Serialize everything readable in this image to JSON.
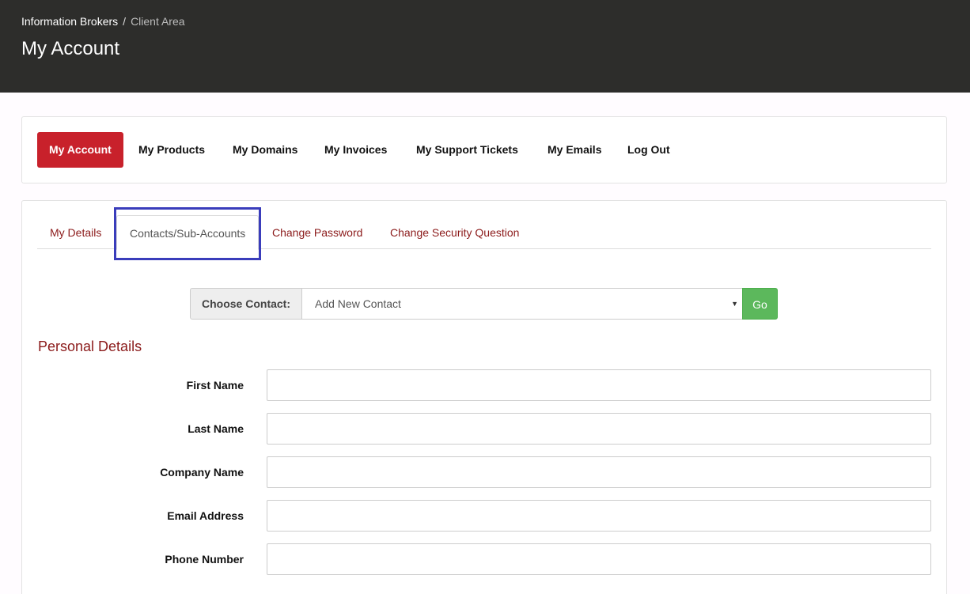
{
  "header": {
    "breadcrumb": {
      "home": "Information Brokers",
      "separator": "/",
      "current": "Client Area"
    },
    "title": "My Account"
  },
  "nav": {
    "items": [
      {
        "label": "My Account",
        "active": true
      },
      {
        "label": "My Products"
      },
      {
        "label": "My Domains"
      },
      {
        "label": "My Invoices"
      },
      {
        "label": "My Support Tickets"
      },
      {
        "label": "My Emails"
      },
      {
        "label": "Log Out"
      }
    ]
  },
  "tabs": {
    "items": [
      {
        "label": "My Details"
      },
      {
        "label": "Contacts/Sub-Accounts",
        "active": true
      },
      {
        "label": "Change Password"
      },
      {
        "label": "Change Security Question"
      }
    ]
  },
  "contact_chooser": {
    "label": "Choose Contact:",
    "selected": "Add New Contact",
    "go_label": "Go"
  },
  "personal_details": {
    "title": "Personal Details",
    "fields": [
      {
        "label": "First Name",
        "value": ""
      },
      {
        "label": "Last Name",
        "value": ""
      },
      {
        "label": "Company Name",
        "value": ""
      },
      {
        "label": "Email Address",
        "value": ""
      },
      {
        "label": "Phone Number",
        "value": ""
      }
    ]
  },
  "colors": {
    "header_bg": "#2d2d2b",
    "accent_red": "#c8212b",
    "link_red": "#8b1a1a",
    "go_green": "#5cb85c",
    "highlight_blue": "#3a3dbb"
  }
}
